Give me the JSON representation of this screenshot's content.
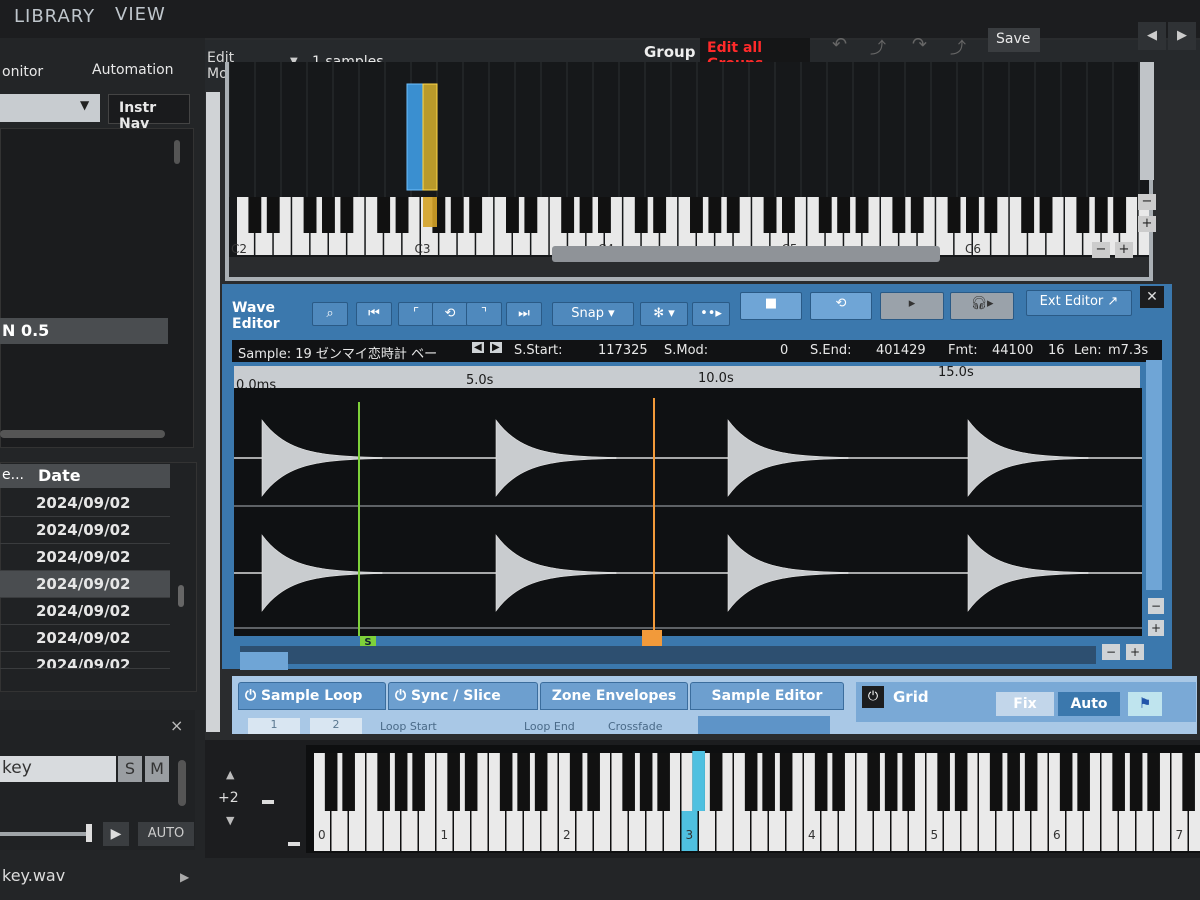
{
  "menu": {
    "library": "LIBRARY",
    "view": "VIEW"
  },
  "left": {
    "tab_monitor": "onitor",
    "tab_automation": "Automation",
    "instr_nav": "Instr Nav",
    "selected_item": "N 0.5",
    "col_short": "e...",
    "col_date": "Date",
    "dates": [
      "2024/09/02",
      "2024/09/02",
      "2024/09/02",
      "2024/09/02",
      "2024/09/02",
      "2024/09/02",
      "2024/09/02"
    ],
    "close_x": "×",
    "key_field": "key",
    "solo": "S",
    "mute": "M",
    "auto": "AUTO",
    "play": "▶"
  },
  "header": {
    "edit_mode": "Edit\nMode",
    "samples": "1 samples",
    "group": "Group",
    "edit_all_groups": "Edit all Groups",
    "save": "Save",
    "edit_all_color": "#ff2a2a"
  },
  "mapview": {
    "octave_labels": [
      "C2",
      "C3",
      "C4",
      "C5",
      "C6"
    ],
    "minus": "−",
    "plus": "+"
  },
  "wave": {
    "title": "Wave\nEditor",
    "snap": "Snap",
    "ext_editor": "Ext Editor ↗",
    "close": "✕",
    "sample_label": "Sample: 19 ゼンマイ恋時計 ベー",
    "s_start_label": "S.Start:",
    "s_start": "117325",
    "s_mod_label": "S.Mod:",
    "s_mod": "0",
    "s_end_label": "S.End:",
    "s_end": "401429",
    "fmt_label": "Fmt:",
    "fmt": "44100",
    "bits": "16",
    "len_label": "Len:",
    "len": "m7.3s",
    "ruler": [
      "0.0ms",
      "5.0s",
      "10.0s",
      "15.0s"
    ],
    "start_marker": "S"
  },
  "tabs": {
    "sample_loop": "Sample Loop",
    "sync_slice": "Sync / Slice",
    "zone_envelopes": "Zone Envelopes",
    "sample_editor": "Sample Editor",
    "grid": "Grid",
    "fix": "Fix",
    "auto": "Auto",
    "loop_start": "Loop Start",
    "loop_end": "Loop End",
    "crossfade": "Crossfade",
    "one": "1",
    "two": "2"
  },
  "bottom": {
    "octave_shift": "+2",
    "octave_numbers": [
      "0",
      "1",
      "2",
      "3",
      "4",
      "5",
      "6",
      "7"
    ]
  },
  "footer": {
    "filename": "key.wav"
  }
}
